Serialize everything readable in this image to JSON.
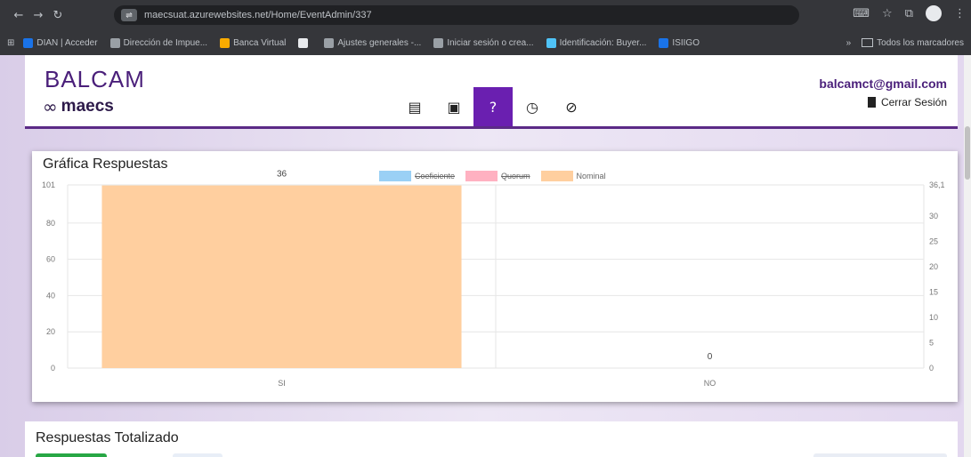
{
  "browser": {
    "url": "maecsuat.azurewebsites.net/Home/EventAdmin/337",
    "bookmarks": [
      {
        "label": "DIAN | Acceder",
        "color": "#1a73e8"
      },
      {
        "label": "Dirección de Impue...",
        "color": "#9aa0a6"
      },
      {
        "label": "Banca Virtual",
        "color": "#f9ab00"
      },
      {
        "label": "",
        "color": "#e8eaed"
      },
      {
        "label": "Ajustes generales -...",
        "color": "#9aa0a6"
      },
      {
        "label": "Iniciar sesión o crea...",
        "color": "#9aa0a6"
      },
      {
        "label": "Identificación: Buyer...",
        "color": "#4fc3f7"
      },
      {
        "label": "ISIIGO",
        "color": "#1a73e8"
      }
    ],
    "overflow": "»",
    "all_bookmarks": "Todos los marcadores"
  },
  "app": {
    "logo_top": "BALCAM",
    "logo_bottom": "maecs",
    "user_email": "balcamct@gmail.com",
    "logout_label": "Cerrar Sesión"
  },
  "nav_icons": [
    {
      "name": "calendar-icon",
      "glyph": "▤",
      "active": false
    },
    {
      "name": "badge-icon",
      "glyph": "▣",
      "active": false
    },
    {
      "name": "question-icon",
      "glyph": "?",
      "active": true
    },
    {
      "name": "timer-icon",
      "glyph": "◷",
      "active": false
    },
    {
      "name": "cancel-icon",
      "glyph": "⊘",
      "active": false
    }
  ],
  "chart_card": {
    "title": "Gráfica Respuestas"
  },
  "totals_card": {
    "title": "Respuestas Totalizado"
  },
  "chart_data": {
    "type": "bar",
    "categories": [
      "SI",
      "NO"
    ],
    "series": [
      {
        "name": "Coeficiente",
        "values": [
          0,
          0
        ],
        "color": "#9ad0f5",
        "hidden": true
      },
      {
        "name": "Quorum",
        "values": [
          0,
          0
        ],
        "color": "#ffb1c1",
        "hidden": true
      },
      {
        "name": "Nominal",
        "values": [
          36,
          0
        ],
        "color": "#ffcf9f",
        "hidden": false
      }
    ],
    "data_labels": [
      "36",
      "0"
    ],
    "y_left": {
      "min": 0,
      "max": 101,
      "ticks": [
        "0",
        "20",
        "40",
        "60",
        "80",
        "101"
      ],
      "tick_values": [
        0,
        20,
        40,
        60,
        80,
        101
      ]
    },
    "y_right": {
      "min": 0,
      "max": 36.1,
      "ticks": [
        "0",
        "5",
        "10",
        "15",
        "20",
        "25",
        "30",
        "36,1"
      ],
      "tick_values": [
        0,
        5,
        10,
        15,
        20,
        25,
        30,
        36.1
      ]
    },
    "legend_position": "top",
    "grid": true
  }
}
